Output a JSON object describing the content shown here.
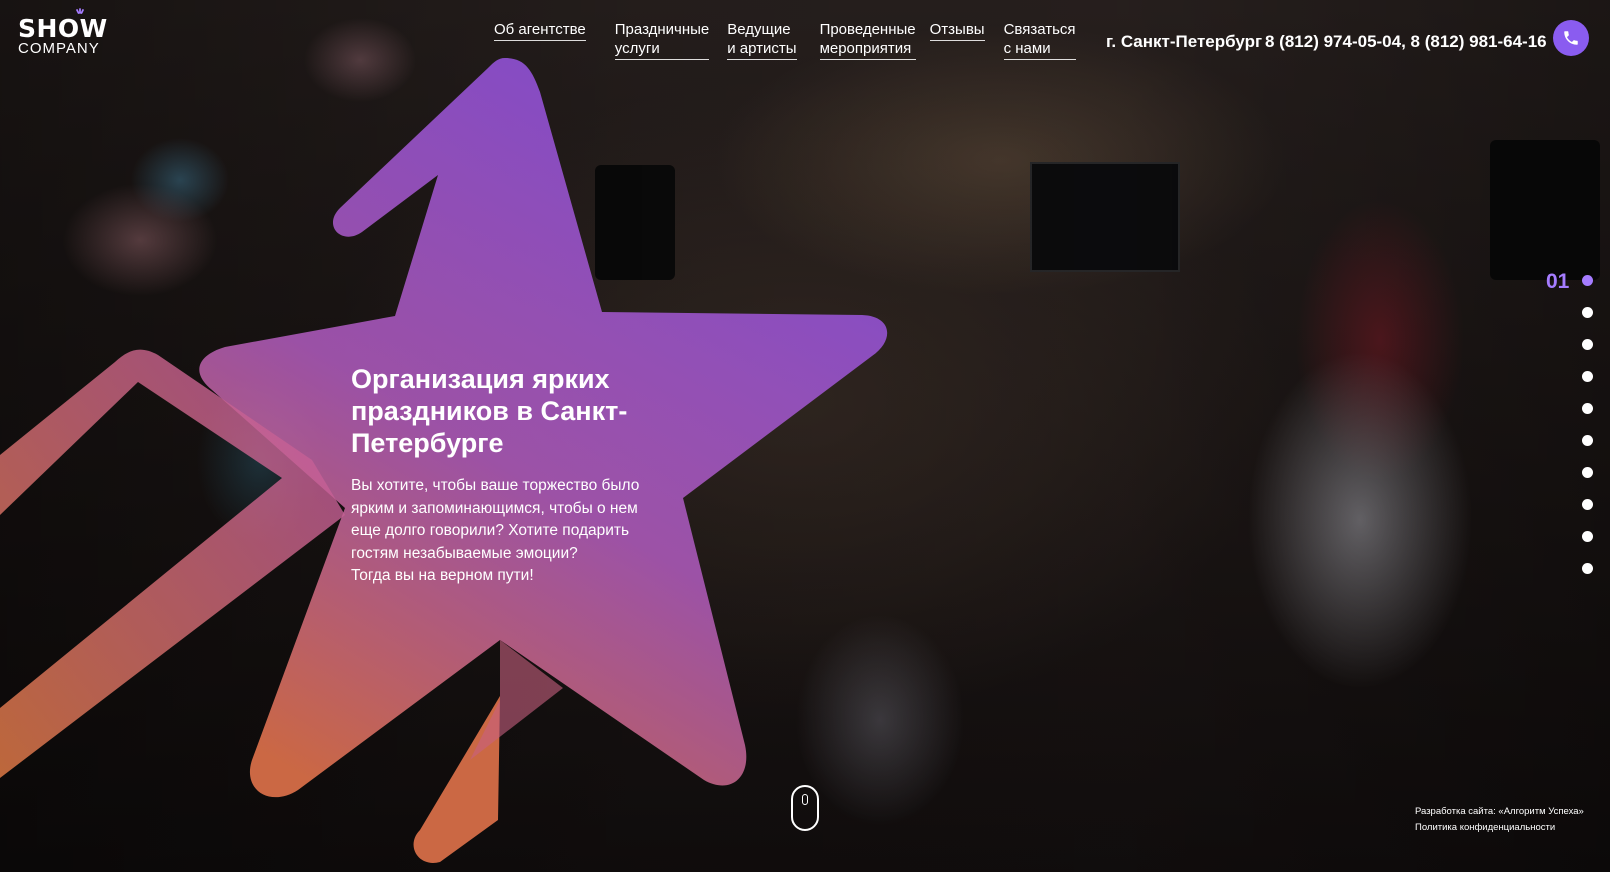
{
  "logo": {
    "top": "SHOW",
    "bottom": "COMPANY"
  },
  "nav": [
    {
      "label": "Об агентстве"
    },
    {
      "label": "Праздничные\nуслуги"
    },
    {
      "label": "Ведущие\nи артисты"
    },
    {
      "label": "Проведенные\nмероприятия"
    },
    {
      "label": "Отзывы"
    },
    {
      "label": "Связаться\nс нами"
    }
  ],
  "contacts": {
    "city": "г. Санкт-Петербург",
    "phones": "8 (812) 974-05-04, 8 (812) 981-64-16",
    "call_icon": "phone-icon"
  },
  "hero": {
    "title": "Организация ярких праздников в Санкт-Петербурге",
    "text": "Вы хотите, чтобы ваше торжество было ярким и запоминающимся, чтобы о нем еще долго говорили? Хотите подарить гостям незабываемые эмоции?\nТогда вы на верном пути!"
  },
  "slider": {
    "current": "01",
    "total_dots": 10,
    "active_index": 0
  },
  "footer": {
    "developer": "Разработка сайта: «Алгоритм Успеха»",
    "privacy": "Политика конфиденциальности"
  },
  "colors": {
    "accent": "#8a5cf0",
    "accent_light": "#a57cff",
    "star_top": "#8a4fe0",
    "star_bottom": "#e0724a"
  }
}
